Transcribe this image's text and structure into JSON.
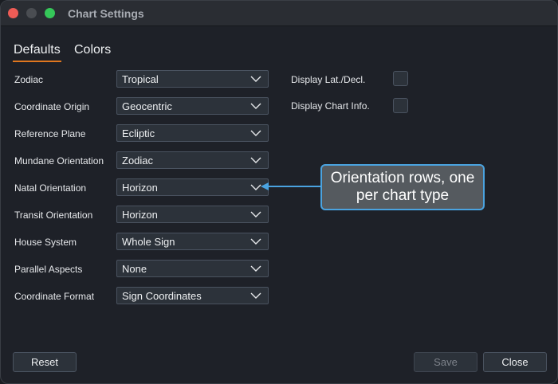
{
  "window": {
    "title": "Chart Settings"
  },
  "tabs": [
    {
      "label": "Defaults",
      "active": true
    },
    {
      "label": "Colors",
      "active": false
    }
  ],
  "rows": [
    {
      "label": "Zodiac",
      "value": "Tropical"
    },
    {
      "label": "Coordinate Origin",
      "value": "Geocentric"
    },
    {
      "label": "Reference Plane",
      "value": "Ecliptic"
    },
    {
      "label": "Mundane Orientation",
      "value": "Zodiac"
    },
    {
      "label": "Natal Orientation",
      "value": "Horizon"
    },
    {
      "label": "Transit Orientation",
      "value": "Horizon"
    },
    {
      "label": "House System",
      "value": "Whole Sign"
    },
    {
      "label": "Parallel Aspects",
      "value": "None"
    },
    {
      "label": "Coordinate Format",
      "value": "Sign Coordinates"
    }
  ],
  "display_options": [
    {
      "label": "Display Lat./Decl.",
      "checked": false
    },
    {
      "label": "Display Chart Info.",
      "checked": false
    }
  ],
  "buttons": {
    "reset": "Reset",
    "save": "Save",
    "close": "Close"
  },
  "callout": {
    "line1": "Orientation rows, one",
    "line2": "per chart type"
  },
  "colors": {
    "accent": "#e0771f",
    "callout_border": "#4aa3e0"
  }
}
